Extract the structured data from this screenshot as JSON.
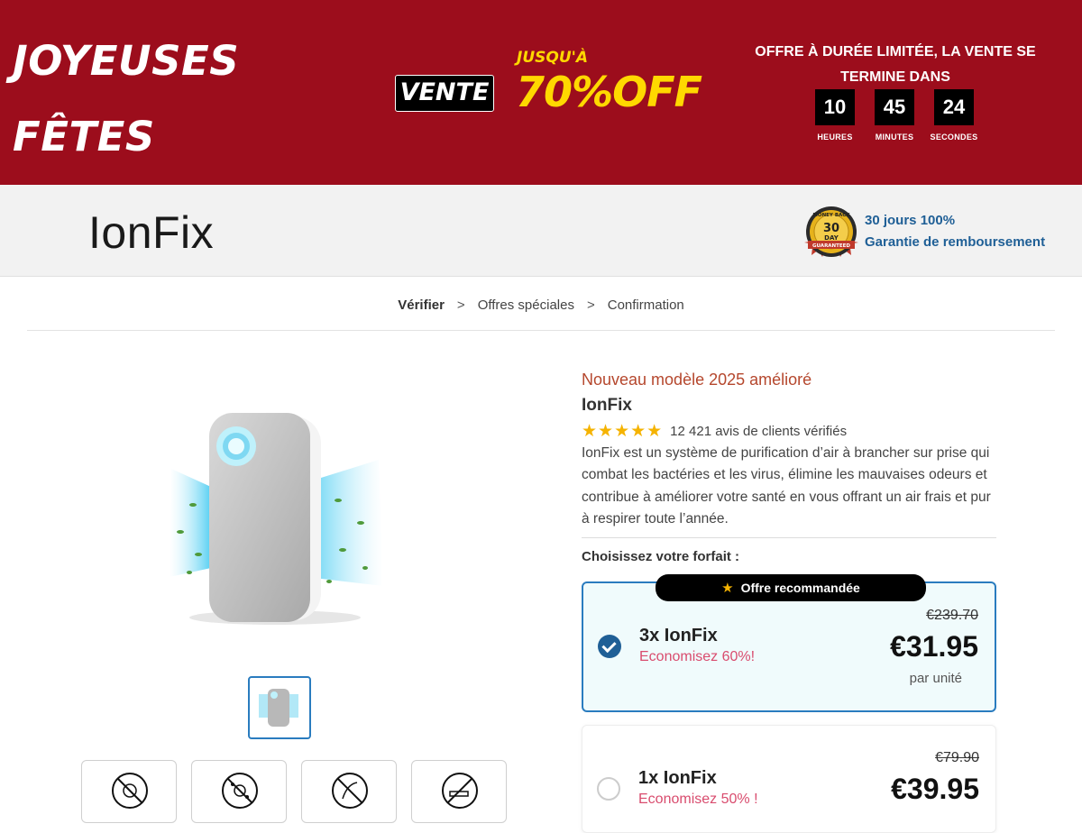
{
  "promo": {
    "holiday_line1": "JOYEUSES",
    "holiday_line2": "FÊTES",
    "sale_chip": "VENTE",
    "up_to": "JUSQU'À",
    "discount": "70%OFF",
    "offer_text": "OFFRE À DURÉE LIMITÉE, LA VENTE SE TERMINE DANS",
    "timer": [
      {
        "value": "10",
        "label": "HEURES"
      },
      {
        "value": "45",
        "label": "MINUTES"
      },
      {
        "value": "24",
        "label": "SECONDES"
      }
    ]
  },
  "header": {
    "logo": "IonFix",
    "badge_top": "MONEY BACK",
    "badge_mid1": "30",
    "badge_mid2": "DAY",
    "badge_bottom": "GUARANTEED",
    "guarantee_line1": "30 jours 100%",
    "guarantee_line2": "Garantie de remboursement"
  },
  "breadcrumb": {
    "step1": "Vérifier",
    "sep": ">",
    "step2": "Offres spéciales",
    "step3": "Confirmation"
  },
  "product": {
    "badge_text": "Nouveau modèle 2025 amélioré",
    "name": "IonFix",
    "stars": "★★★★★",
    "rating_value": 4.5,
    "reviews": "12 421 avis de clients vérifiés",
    "description": "IonFix est un système de purification d’air à brancher sur prise qui combat les bactéries et les virus, élimine les mauvaises odeurs et contribue à améliorer votre santé en vous offrant un air frais et pur à respirer toute l’année.",
    "choose_label": "Choisissez votre forfait :"
  },
  "offers": [
    {
      "ribbon": "Offre recommandée",
      "quantity": "3x IonFix",
      "saving": "Economisez 60%!",
      "old_price": "€239.70",
      "price": "€31.95",
      "per_unit": "par unité",
      "selected": true
    },
    {
      "quantity": "1x IonFix",
      "saving": "Economisez 50% !",
      "old_price": "€79.90",
      "price": "€39.95",
      "selected": false
    }
  ],
  "features": [
    "anti-bacteria-icon",
    "anti-virus-icon",
    "no-allergen-icon",
    "no-smoke-icon"
  ],
  "colors": {
    "banner": "#9c0d1c",
    "accent_yellow": "#ffd800",
    "selected_blue": "#1f5f96",
    "saving_pink": "#d94c6e"
  }
}
